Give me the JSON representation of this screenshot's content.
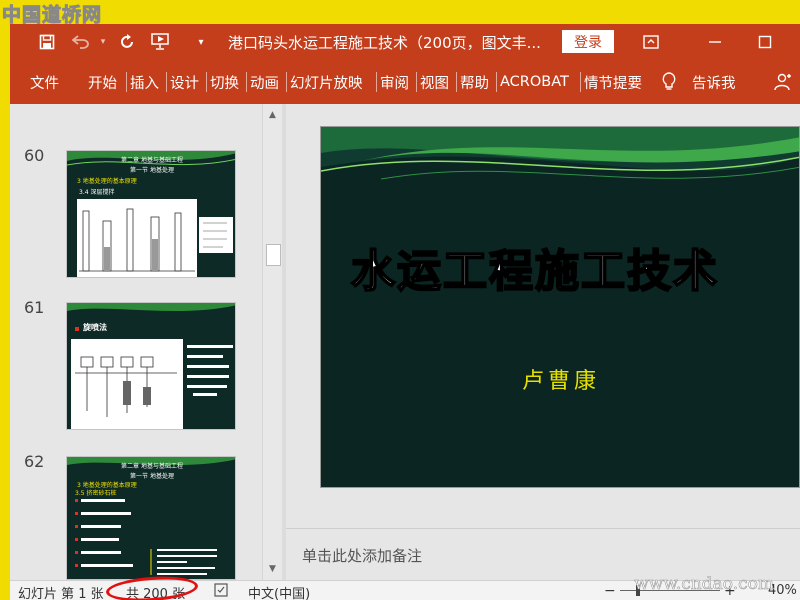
{
  "watermark": {
    "top_left": "中国道桥网",
    "bottom_right": "www.cndao.com"
  },
  "titlebar": {
    "title": "港口码头水运工程施工技术（200页，图文丰...",
    "login_label": "登录"
  },
  "ribbon": {
    "tabs": [
      "文件",
      "开始",
      "插入",
      "设计",
      "切换",
      "动画",
      "幻灯片放映",
      "审阅",
      "视图",
      "帮助",
      "ACROBAT",
      "情节提要"
    ],
    "tell_me": "告诉我"
  },
  "thumbnails": [
    {
      "number": "60",
      "chapter": "第二章  地基与基础工程",
      "section": "第一节   地基处理",
      "subtitle": "3  地基处理的基本原理",
      "subtitle2": "3.4  深层搅拌"
    },
    {
      "number": "61",
      "heading": "旋喷法"
    },
    {
      "number": "62",
      "chapter": "第二章  地基与基础工程",
      "section": "第一节   地基处理",
      "subtitle": "3  地基处理的基本原理",
      "subtitle2": "3.5  挤密砂石桩"
    }
  ],
  "slide": {
    "title": "水运工程施工技术",
    "author": "卢曹康"
  },
  "notes": {
    "placeholder": "单击此处添加备注"
  },
  "statusbar": {
    "slide_label": "幻灯片 第 1 张",
    "count_label": "共 200 张",
    "language": "中文(中国)",
    "zoom": "40%"
  },
  "colors": {
    "accent": "#c43e1c",
    "slide_bg": "#0a2522",
    "author": "#e6e000",
    "highlight": "#e01010"
  }
}
